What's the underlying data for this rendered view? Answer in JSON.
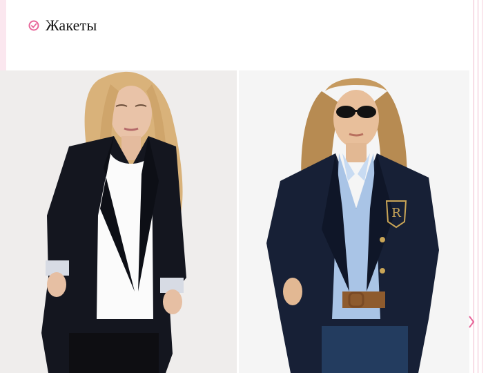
{
  "slide": {
    "bullet_text": "Жакеты",
    "bullet_icon": "circle-checkmark-icon",
    "accent_color": "#e8669a",
    "frame_color": "#f0b7cb"
  },
  "photos": [
    {
      "name": "blonde-woman-black-blazer-white-tee-photo"
    },
    {
      "name": "woman-navy-crest-blazer-blue-shirt-photo"
    }
  ]
}
